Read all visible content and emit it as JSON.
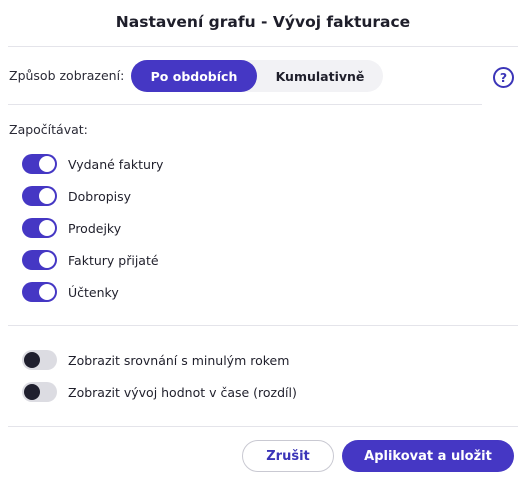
{
  "dialog": {
    "title": "Nastavení grafu - Vývoj fakturace"
  },
  "display_mode": {
    "label": "Způsob zobrazení:",
    "options": [
      {
        "label": "Po obdobích",
        "selected": true
      },
      {
        "label": "Kumulativně",
        "selected": false
      }
    ],
    "help_icon": "?"
  },
  "include": {
    "label": "Započítávat:",
    "items": [
      {
        "label": "Vydané faktury",
        "on": true
      },
      {
        "label": "Dobropisy",
        "on": true
      },
      {
        "label": "Prodejky",
        "on": true
      },
      {
        "label": "Faktury přijaté",
        "on": true
      },
      {
        "label": "Účtenky",
        "on": true
      }
    ]
  },
  "options": {
    "items": [
      {
        "label": "Zobrazit srovnání s minulým rokem",
        "on": false
      },
      {
        "label": "Zobrazit vývoj hodnot v čase (rozdíl)",
        "on": false
      }
    ]
  },
  "footer": {
    "cancel_label": "Zrušit",
    "apply_label": "Aplikovat a uložit"
  },
  "colors": {
    "accent": "#4537c4",
    "toggle_off_track": "#dcdce2",
    "toggle_off_knob": "#1f1f2e"
  }
}
